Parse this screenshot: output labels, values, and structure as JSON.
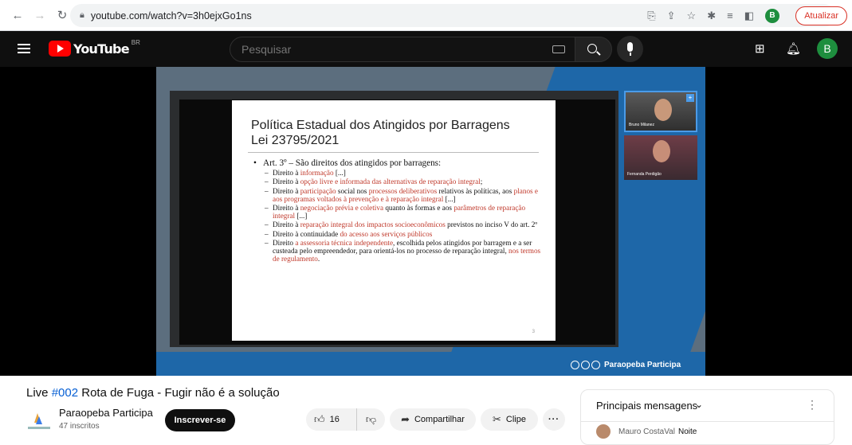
{
  "browser": {
    "url": "youtube.com/watch?v=3h0ejxGo1ns",
    "profile_initial": "B",
    "update_label": "Atualizar"
  },
  "header": {
    "logo_text": "YouTube",
    "region": "BR",
    "search_placeholder": "Pesquisar",
    "avatar_initial": "B"
  },
  "slide": {
    "title_line1": "Política Estadual dos Atingidos por Barragens",
    "title_line2": "Lei 23795/2021",
    "article": "Art. 3º – São direitos dos atingidos por barragens:",
    "page_number": "3"
  },
  "cams": [
    {
      "name": "Bruno Milanez"
    },
    {
      "name": "Fernanda Perdigão"
    }
  ],
  "video_brand": "Paraopeba Participa",
  "video": {
    "title_prefix": "Live ",
    "hashtag": "#002",
    "title_rest": " Rota de Fuga - Fugir não é a solução"
  },
  "channel": {
    "name": "Paraopeba Participa",
    "subscribers": "47 inscritos",
    "subscribe_label": "Inscrever-se"
  },
  "actions": {
    "likes": "16",
    "share_label": "Compartilhar",
    "clip_label": "Clipe",
    "more_label": "···"
  },
  "chat": {
    "title": "Principais mensagens",
    "messages": [
      {
        "author": "Mauro CostaVal",
        "text": "Noite"
      }
    ]
  }
}
